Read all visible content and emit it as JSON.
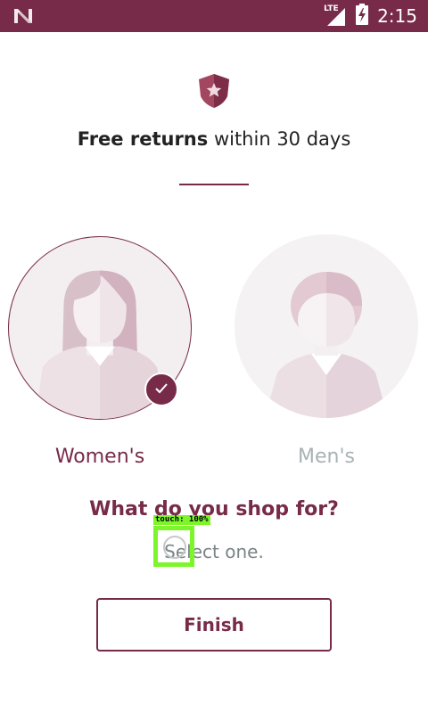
{
  "status_bar": {
    "network_type": "LTE",
    "time": "2:15",
    "left_icon": "n-notification-icon",
    "signal_icon": "signal-icon",
    "battery_icon": "battery-charging-icon",
    "background_color": "#772b48"
  },
  "header": {
    "badge_icon": "shield-star-icon",
    "headline_bold": "Free returns",
    "headline_rest": " within 30 days"
  },
  "options": [
    {
      "label": "Women's",
      "selected": true,
      "avatar_icon": "female-avatar-icon"
    },
    {
      "label": "Men's",
      "selected": false,
      "avatar_icon": "male-avatar-icon"
    }
  ],
  "selected_icon": "checkmark-icon",
  "question": "What do you shop for?",
  "hint": "Select one.",
  "finish_button": {
    "label": "Finish"
  },
  "touch_overlay": {
    "label": "touch: 100%"
  },
  "colors": {
    "accent": "#772b48",
    "muted_text": "#a9b2b4",
    "touch_highlight": "#7cf52a"
  }
}
